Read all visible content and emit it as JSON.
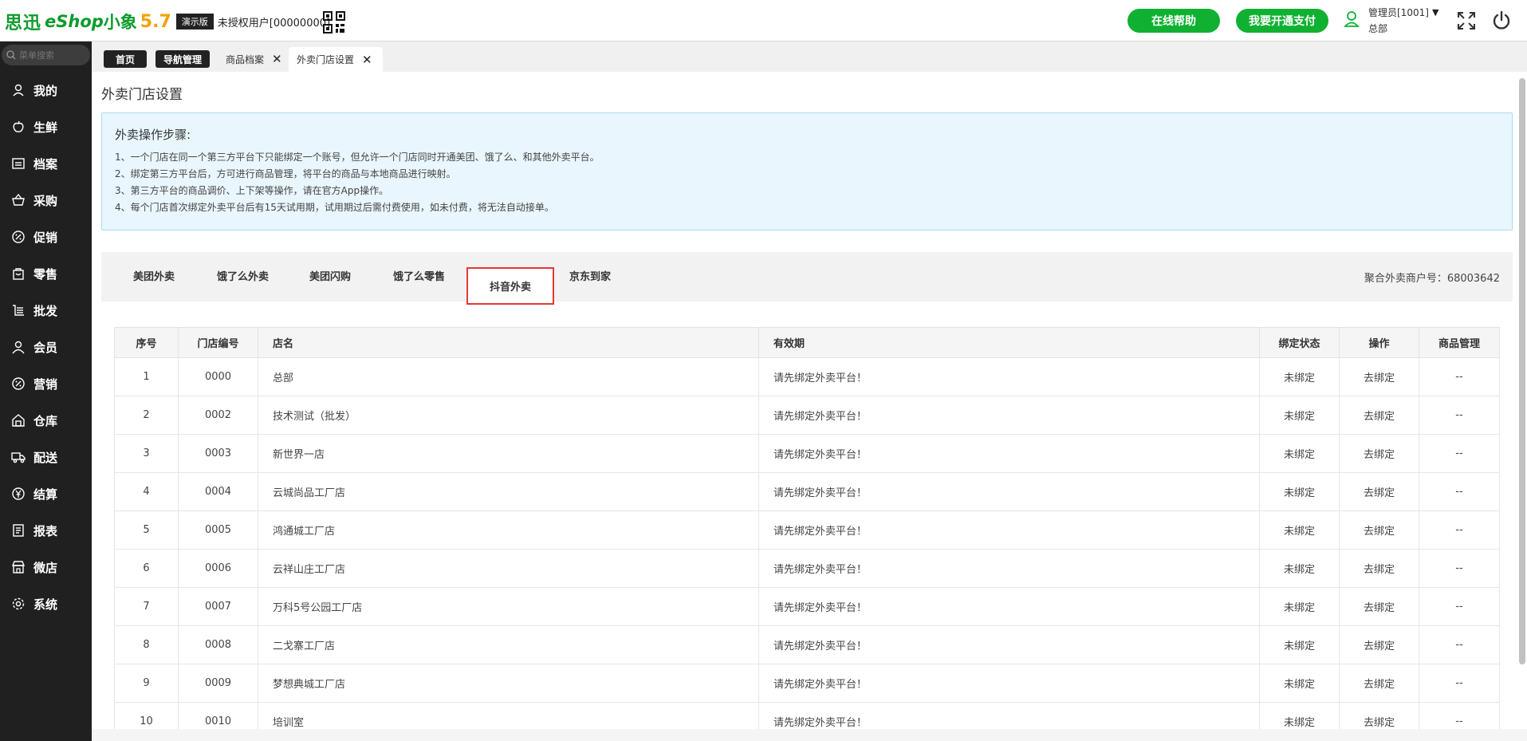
{
  "header": {
    "brand_cn": "思迅",
    "brand_eshop": "eShop",
    "brand_name": "小象",
    "version": "5.7",
    "demo_badge": "演示版",
    "unauth_user": "未授权用户[00000000]",
    "help_button": "在线帮助",
    "pay_button": "我要开通支付",
    "admin_name": "管理员[1001]",
    "admin_sub": "总部",
    "colors": {
      "brand_green": "#0e9b2c",
      "button_green": "#10b132",
      "version_orange": "#f2a200"
    }
  },
  "sidebar": {
    "search_placeholder": "菜单搜索",
    "items": [
      {
        "label": "我的",
        "icon": "user-icon"
      },
      {
        "label": "生鲜",
        "icon": "apple-icon"
      },
      {
        "label": "档案",
        "icon": "archive-icon"
      },
      {
        "label": "采购",
        "icon": "basket-icon"
      },
      {
        "label": "促销",
        "icon": "promotion-icon"
      },
      {
        "label": "零售",
        "icon": "bag-icon"
      },
      {
        "label": "批发",
        "icon": "wholesale-icon"
      },
      {
        "label": "会员",
        "icon": "member-icon"
      },
      {
        "label": "营销",
        "icon": "marketing-icon"
      },
      {
        "label": "仓库",
        "icon": "warehouse-icon"
      },
      {
        "label": "配送",
        "icon": "truck-icon"
      },
      {
        "label": "结算",
        "icon": "yen-icon"
      },
      {
        "label": "报表",
        "icon": "report-icon"
      },
      {
        "label": "微店",
        "icon": "shop-icon"
      },
      {
        "label": "系统",
        "icon": "gear-icon"
      }
    ]
  },
  "tabs": {
    "home": "首页",
    "nav_manage": "导航管理",
    "product_archive": "商品档案",
    "takeout_settings": "外卖门店设置",
    "close_symbol": "✕"
  },
  "page": {
    "title": "外卖门店设置",
    "info_heading": "外卖操作步骤:",
    "info_lines": [
      "1、一个门店在同一个第三方平台下只能绑定一个账号，但允许一个门店同时开通美团、饿了么、和其他外卖平台。",
      "2、绑定第三方平台后，方可进行商品管理，将平台的商品与本地商品进行映射。",
      "3、第三方平台的商品调价、上下架等操作，请在官方App操作。",
      "4、每个门店首次绑定外卖平台后有15天试用期，试用期过后需付费使用，如未付费，将无法自动接单。"
    ],
    "platforms": [
      "美团外卖",
      "饿了么外卖",
      "美团闪购",
      "饿了么零售",
      "抖音外卖",
      "京东到家"
    ],
    "active_platform": "抖音外卖",
    "merchant_label": "聚合外卖商户号：68003642"
  },
  "table": {
    "headers": [
      "序号",
      "门店编号",
      "店名",
      "有效期",
      "绑定状态",
      "操作",
      "商品管理"
    ],
    "rows": [
      [
        "1",
        "0000",
        "总部",
        "请先绑定外卖平台！",
        "未绑定",
        "去绑定",
        "--"
      ],
      [
        "2",
        "0002",
        "技术测试（批发）",
        "请先绑定外卖平台！",
        "未绑定",
        "去绑定",
        "--"
      ],
      [
        "3",
        "0003",
        "新世界一店",
        "请先绑定外卖平台！",
        "未绑定",
        "去绑定",
        "--"
      ],
      [
        "4",
        "0004",
        "云城尚品工厂店",
        "请先绑定外卖平台！",
        "未绑定",
        "去绑定",
        "--"
      ],
      [
        "5",
        "0005",
        "鸿通城工厂店",
        "请先绑定外卖平台！",
        "未绑定",
        "去绑定",
        "--"
      ],
      [
        "6",
        "0006",
        "云祥山庄工厂店",
        "请先绑定外卖平台！",
        "未绑定",
        "去绑定",
        "--"
      ],
      [
        "7",
        "0007",
        "万科5号公园工厂店",
        "请先绑定外卖平台！",
        "未绑定",
        "去绑定",
        "--"
      ],
      [
        "8",
        "0008",
        "二戈寨工厂店",
        "请先绑定外卖平台！",
        "未绑定",
        "去绑定",
        "--"
      ],
      [
        "9",
        "0009",
        "梦想典城工厂店",
        "请先绑定外卖平台！",
        "未绑定",
        "去绑定",
        "--"
      ],
      [
        "10",
        "0010",
        "培训室",
        "请先绑定外卖平台！",
        "未绑定",
        "去绑定",
        "--"
      ]
    ]
  }
}
